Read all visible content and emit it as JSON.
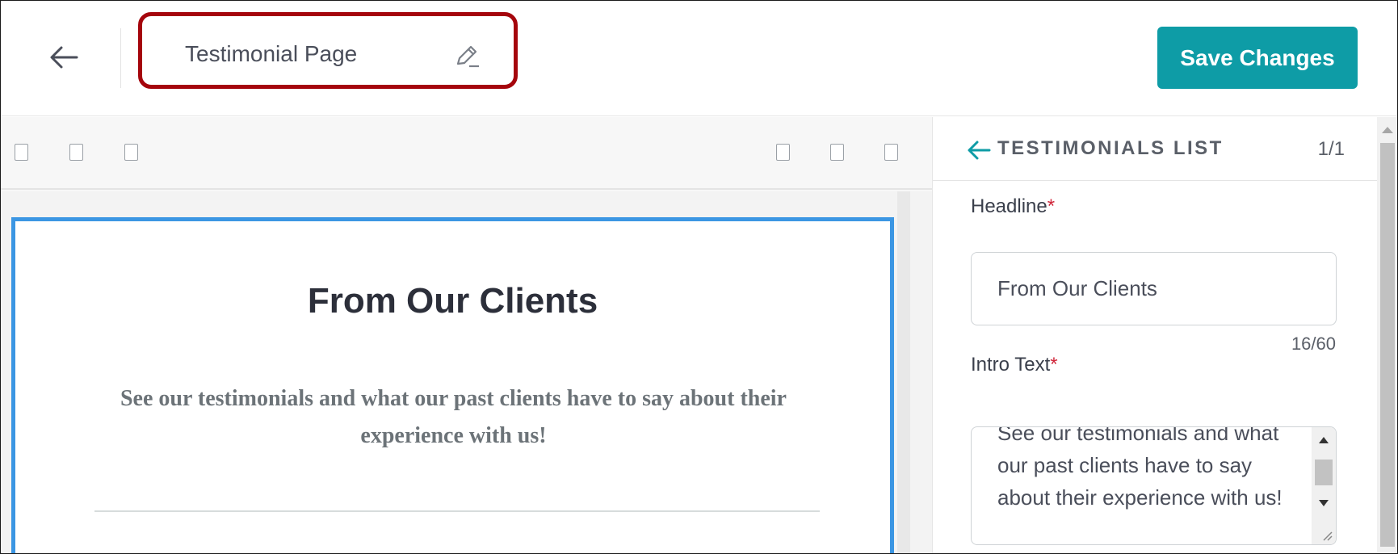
{
  "header": {
    "page_title": "Testimonial Page",
    "save_label": "Save Changes",
    "back_icon": "arrow-left-icon",
    "edit_icon": "pencil-icon",
    "accent_color": "#0e9ca6",
    "highlight_color": "#a5050c"
  },
  "toolbar": {
    "left_icons": [
      "toolbar-icon",
      "toolbar-icon",
      "toolbar-icon"
    ],
    "right_icons": [
      "toolbar-icon",
      "toolbar-icon",
      "toolbar-icon"
    ]
  },
  "preview": {
    "title": "From Our Clients",
    "intro": "See our testimonials and what our past clients have to say about their experience with us!",
    "selection_color": "#3b96e3"
  },
  "panel": {
    "title": "TESTIMONIALS LIST",
    "count": "1/1",
    "headline_label": "Headline",
    "headline_value": "From Our Clients",
    "headline_counter": "16/60",
    "intro_label": "Intro Text",
    "intro_value": "See our testimonials and what our past clients have to say about their experience with us!",
    "required_mark": "*"
  }
}
